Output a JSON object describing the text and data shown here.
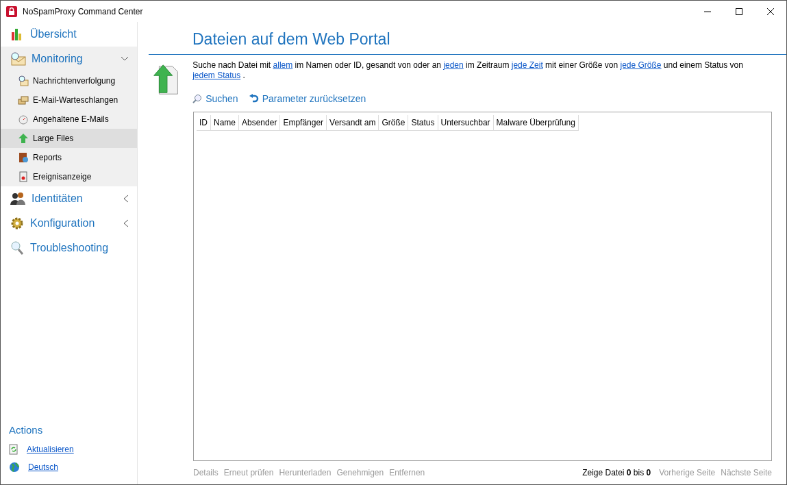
{
  "window": {
    "title": "NoSpamProxy Command Center"
  },
  "sidebar": {
    "items": [
      {
        "label": "Übersicht",
        "kind": "page",
        "selected": false
      },
      {
        "label": "Monitoring",
        "kind": "group",
        "expanded": true,
        "selected": false,
        "children": [
          {
            "label": "Nachrichtenverfolgung",
            "selected": false
          },
          {
            "label": "E-Mail-Warteschlangen",
            "selected": false
          },
          {
            "label": "Angehaltene E-Mails",
            "selected": false
          },
          {
            "label": "Large Files",
            "selected": true
          },
          {
            "label": "Reports",
            "selected": false
          },
          {
            "label": "Ereignisanzeige",
            "selected": false
          }
        ]
      },
      {
        "label": "Identitäten",
        "kind": "group",
        "expanded": false,
        "selected": false
      },
      {
        "label": "Konfiguration",
        "kind": "group",
        "expanded": false,
        "selected": false
      },
      {
        "label": "Troubleshooting",
        "kind": "page",
        "selected": false
      }
    ]
  },
  "actions": {
    "title": "Actions",
    "items": [
      {
        "label": "Aktualisieren"
      },
      {
        "label": "Deutsch"
      }
    ]
  },
  "main": {
    "title": "Dateien auf dem Web Portal",
    "query": [
      {
        "text": "Suche nach Datei mit ",
        "kind": "text"
      },
      {
        "text": "allem",
        "kind": "link"
      },
      {
        "text": " im Namen oder ID, gesandt von oder an ",
        "kind": "text"
      },
      {
        "text": "jeden",
        "kind": "link"
      },
      {
        "text": " im Zeitraum ",
        "kind": "text"
      },
      {
        "text": "jede Zeit",
        "kind": "link"
      },
      {
        "text": " mit einer Größe von ",
        "kind": "text"
      },
      {
        "text": "jede Größe",
        "kind": "link"
      },
      {
        "text": " und einem Status von ",
        "kind": "text"
      },
      {
        "text": "jedem Status",
        "kind": "link"
      },
      {
        "text": " .",
        "kind": "text"
      }
    ],
    "toolbar": [
      {
        "label": "Suchen"
      },
      {
        "label": "Parameter zurücksetzen"
      }
    ],
    "table": {
      "columns": [
        "ID",
        "Name",
        "Absender",
        "Empfänger",
        "Versandt am",
        "Größe",
        "Status",
        "Untersuchbar",
        "Malware Überprüfung"
      ]
    },
    "row_actions": [
      {
        "label": "Details",
        "disabled": true
      },
      {
        "label": "Erneut prüfen",
        "disabled": true
      },
      {
        "label": "Herunterladen",
        "disabled": true
      },
      {
        "label": "Genehmigen",
        "disabled": true
      },
      {
        "label": "Entfernen",
        "disabled": true
      }
    ],
    "pager": {
      "summary": "Zeige Datei **0** bis **0**",
      "buttons": [
        {
          "label": "Vorherige Seite",
          "disabled": true
        },
        {
          "label": "Nächste Seite",
          "disabled": true
        }
      ]
    }
  }
}
